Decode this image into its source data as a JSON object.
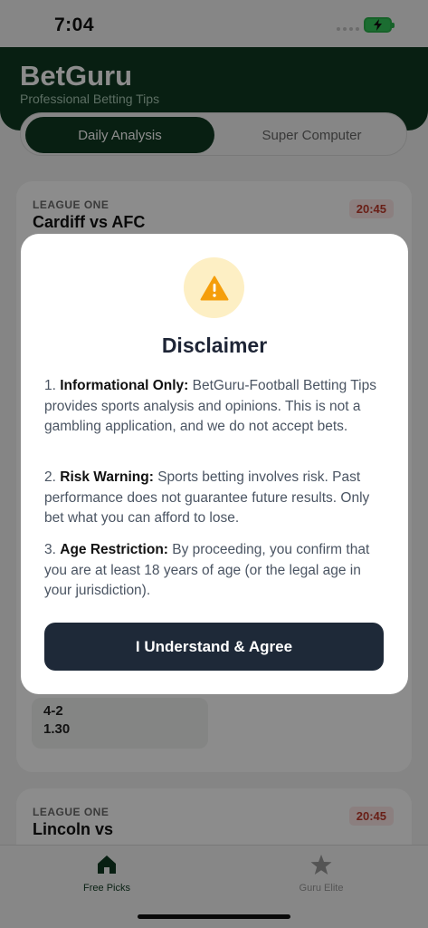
{
  "status_bar": {
    "time": "7:04",
    "battery_icon": "battery-charging-icon"
  },
  "header": {
    "brand": "BetGuru",
    "subtitle": "Professional Betting Tips"
  },
  "tabs": [
    {
      "label": "Daily Analysis",
      "active": true
    },
    {
      "label": "Super Computer",
      "active": false
    }
  ],
  "matches": [
    {
      "league": "LEAGUE ONE",
      "teams": "Cardiff vs AFC",
      "time": "20:45",
      "pick_score": "4-2",
      "pick_odds": "1.30"
    },
    {
      "league": "LEAGUE ONE",
      "teams": "Lincoln vs",
      "time": "20:45"
    }
  ],
  "bottom_nav": [
    {
      "label": "Free Picks",
      "icon": "home-icon",
      "active": true
    },
    {
      "label": "Guru Elite",
      "icon": "star-icon",
      "active": false
    }
  ],
  "modal": {
    "icon": "warning-icon",
    "title": "Disclaimer",
    "items": [
      {
        "number": "1.",
        "heading": "Informational Only:",
        "text": "BetGuru-Football Betting Tips provides sports analysis and opinions. This is not a gambling application, and we do not accept bets."
      },
      {
        "number": "2.",
        "heading": "Risk Warning:",
        "text": "Sports betting involves risk. Past performance does not guarantee future results. Only bet what you can afford to lose."
      },
      {
        "number": "3.",
        "heading": "Age Restriction:",
        "text": "By proceeding, you confirm that you are at least 18 years of age (or the legal age in your jurisdiction)."
      }
    ],
    "button_label": "I Understand & Agree"
  },
  "colors": {
    "brand_dark": "#103a22",
    "button": "#1e2938",
    "warning": "#f59e0b",
    "time_badge": "#c0392b"
  }
}
